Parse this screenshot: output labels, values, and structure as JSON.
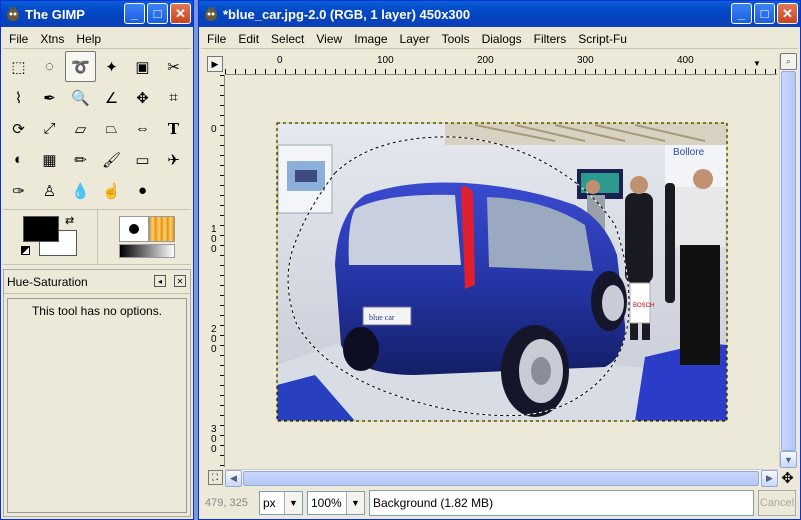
{
  "toolbox": {
    "title": "The GIMP",
    "menu": [
      "File",
      "Xtns",
      "Help"
    ],
    "dock_title": "Hue-Saturation",
    "dock_message": "This tool has no options.",
    "tools": [
      "rect-select-icon",
      "ellipse-select-icon",
      "lasso-icon",
      "fuzzy-select-icon",
      "select-by-color-icon",
      "scissors-icon",
      "paths-icon",
      "color-picker-icon",
      "magnify-icon",
      "measure-icon",
      "move-icon",
      "crop-icon",
      "rotate-icon",
      "scale-icon",
      "shear-icon",
      "perspective-icon",
      "flip-icon",
      "text-icon",
      "bucket-fill-icon",
      "blend-icon",
      "pencil-icon",
      "paintbrush-icon",
      "eraser-icon",
      "airbrush-icon",
      "ink-icon",
      "clone-icon",
      "blur-icon",
      "smudge-icon",
      "dodge-burn-icon"
    ],
    "selected_tool": 2,
    "fg_color": "#000000",
    "bg_color": "#ffffff"
  },
  "image_window": {
    "title": "*blue_car.jpg-2.0 (RGB, 1 layer) 450x300",
    "menu": [
      "File",
      "Edit",
      "Select",
      "View",
      "Image",
      "Layer",
      "Tools",
      "Dialogs",
      "Filters",
      "Script-Fu"
    ],
    "ruler_top_labels": [
      "0",
      "100",
      "200",
      "300",
      "400"
    ],
    "ruler_left_labels": [
      "0",
      "100",
      "200",
      "300"
    ],
    "coords": "479, 325",
    "unit": "px",
    "zoom": "100%",
    "status_message": "Background (1.82 MB)",
    "cancel_label": "Cancel",
    "canvas_bg": "#ece9d8"
  }
}
